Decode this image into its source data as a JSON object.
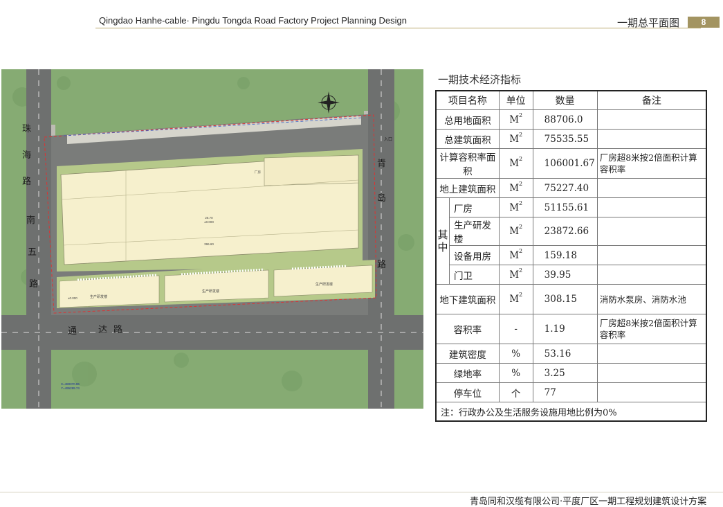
{
  "header": {
    "title": "Qingdao Hanhe-cable· Pingdu Tongda Road Factory Project Planning Design",
    "section": "一期总平面图",
    "page_number": "8"
  },
  "site_plan": {
    "labels": {
      "entrance": "入口",
      "road_left": [
        "珠",
        "海",
        "路",
        "南",
        "五",
        "路"
      ],
      "road_right": [
        "青",
        "岛",
        "路"
      ],
      "road_bottom": [
        "通",
        "达",
        "路"
      ],
      "factory_small": "厂房",
      "main_building_area": "26.70",
      "main_building_elev": "±0.000",
      "main_building_length": "396.60",
      "rnd_label": "生产研发楼",
      "rnd_elev": "±0.000",
      "gate": "门卫",
      "coord_x": "X=480370.86",
      "coord_y": "Y=495289.74"
    }
  },
  "indicators": {
    "title": "一期技术经济指标",
    "headers": [
      "项目名称",
      "单位",
      "数量",
      "备注"
    ],
    "unit_sq": "M",
    "unit_sq_sup": "2",
    "group_label": [
      "其",
      "中"
    ],
    "rows": {
      "total_land": {
        "name": "总用地面积",
        "qty": "88706.0"
      },
      "total_build": {
        "name": "总建筑面积",
        "qty": "75535.55"
      },
      "far_area": {
        "name": "计算容积率面积",
        "qty": "106001.67",
        "note": "厂房超8米按2倍面积计算容积率"
      },
      "above_ground": {
        "name": "地上建筑面积",
        "qty": "75227.40"
      },
      "factory": {
        "name": "厂房",
        "qty": "51155.61"
      },
      "rnd": {
        "name": "生产研发楼",
        "qty": "23872.66"
      },
      "equip": {
        "name": "设备用房",
        "qty": "159.18"
      },
      "guard": {
        "name": "门卫",
        "qty": "39.95"
      },
      "underground": {
        "name": "地下建筑面积",
        "qty": "308.15",
        "note": "消防水泵房、消防水池"
      },
      "far": {
        "name": "容积率",
        "unit": "-",
        "qty": "1.19",
        "note": "厂房超8米按2倍面积计算容积率"
      },
      "density": {
        "name": "建筑密度",
        "unit": "%",
        "qty": "53.16"
      },
      "green": {
        "name": "绿地率",
        "unit": "%",
        "qty": "3.25"
      },
      "parking": {
        "name": "停车位",
        "unit": "个",
        "qty": "77"
      }
    },
    "footnote": "注：行政办公及生活服务设施用地比例为0%"
  },
  "footer": {
    "text": "青岛同和汉缆有限公司·平度厂区一期工程规划建筑设计方案"
  },
  "colors": {
    "accent": "#a39461",
    "grass": "#7fa86a",
    "road": "#6f7170",
    "building": "#f6f0cd"
  }
}
